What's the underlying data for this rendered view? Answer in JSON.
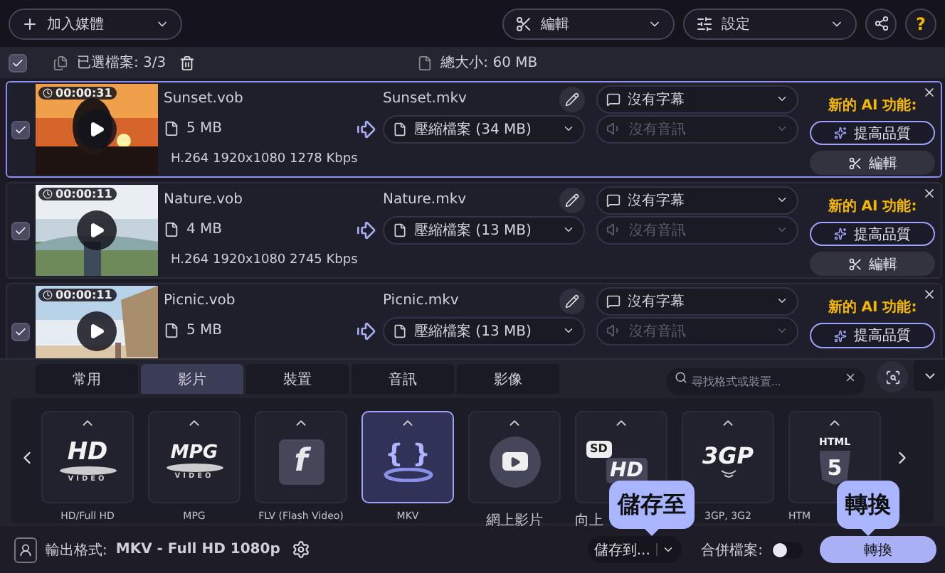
{
  "toolbar": {
    "add_media": "加入媒體",
    "edit": "編輯",
    "settings": "設定",
    "help": "?"
  },
  "selection_bar": {
    "checked": true,
    "selected_files": "已選檔案: 3/3",
    "total_size": "總大小: 60 MB"
  },
  "files": [
    {
      "checked": true,
      "selected": true,
      "duration": "00:00:31",
      "source_name": "Sunset.vob",
      "size": "5 MB",
      "codec": "H.264 1920x1080 1278 Kbps",
      "output_name": "Sunset.mkv",
      "output_option": "壓縮檔案 (34 MB)",
      "subtitle": "沒有字幕",
      "audio": {
        "label": "沒有音訊",
        "disabled": true
      },
      "ai_label": "新的 AI 功能:",
      "enhance": "提高品質",
      "edit": "編輯"
    },
    {
      "checked": true,
      "selected": false,
      "duration": "00:00:11",
      "source_name": "Nature.vob",
      "size": "4 MB",
      "codec": "H.264 1920x1080 2745 Kbps",
      "output_name": "Nature.mkv",
      "output_option": "壓縮檔案 (13 MB)",
      "subtitle": "沒有字幕",
      "audio": {
        "label": "沒有音訊",
        "disabled": true
      },
      "ai_label": "新的 AI 功能:",
      "enhance": "提高品質",
      "edit": "編輯"
    },
    {
      "checked": true,
      "selected": false,
      "duration": "00:00:11",
      "source_name": "Picnic.vob",
      "size": "5 MB",
      "output_name": "Picnic.mkv",
      "output_option": "壓縮檔案 (13 MB)",
      "subtitle": "沒有字幕",
      "audio": {
        "label": "沒有音訊",
        "disabled": true
      },
      "ai_label": "新的 AI 功能:",
      "enhance": "提高品質"
    }
  ],
  "format_tabs": [
    {
      "label": "常用",
      "selected": false
    },
    {
      "label": "影片",
      "selected": true
    },
    {
      "label": "裝置",
      "selected": false
    },
    {
      "label": "音訊",
      "selected": false
    },
    {
      "label": "影像",
      "selected": false
    }
  ],
  "search": {
    "placeholder": "尋找格式或裝置..."
  },
  "formats": [
    {
      "kind": "disc",
      "logo": [
        "HD",
        "VIDEO"
      ],
      "label": "HD/Full HD",
      "selected": false,
      "covered": false
    },
    {
      "kind": "disc",
      "logo": [
        "MPG",
        "VIDEO"
      ],
      "label": "MPG",
      "selected": false,
      "covered": false
    },
    {
      "kind": "flash",
      "logo": [
        "f"
      ],
      "label": "FLV (Flash Video)",
      "selected": false,
      "covered": false
    },
    {
      "kind": "braces",
      "logo": [
        "{ }"
      ],
      "label": "MKV",
      "selected": true,
      "covered": false
    },
    {
      "kind": "play",
      "label": "網上影片",
      "selected": false,
      "covered": false
    },
    {
      "kind": "sdhd",
      "logo": [
        "SD",
        "HD"
      ],
      "label": "向上",
      "selected": false,
      "covered": true
    },
    {
      "kind": "waves",
      "logo": [
        "3GP"
      ],
      "label": "3GP, 3G2",
      "selected": false,
      "covered": false
    },
    {
      "kind": "html",
      "logo": [
        "HTML",
        "5"
      ],
      "label": "HTM",
      "selected": false,
      "covered": true
    }
  ],
  "output": {
    "label": "輸出格式:",
    "value": "MKV - Full HD 1080p"
  },
  "save_to": {
    "label": "儲存到...",
    "tooltip": "儲存至"
  },
  "merge": {
    "label": "合併檔案:",
    "on": false
  },
  "convert": {
    "label": "轉換",
    "tooltip": "轉換"
  }
}
